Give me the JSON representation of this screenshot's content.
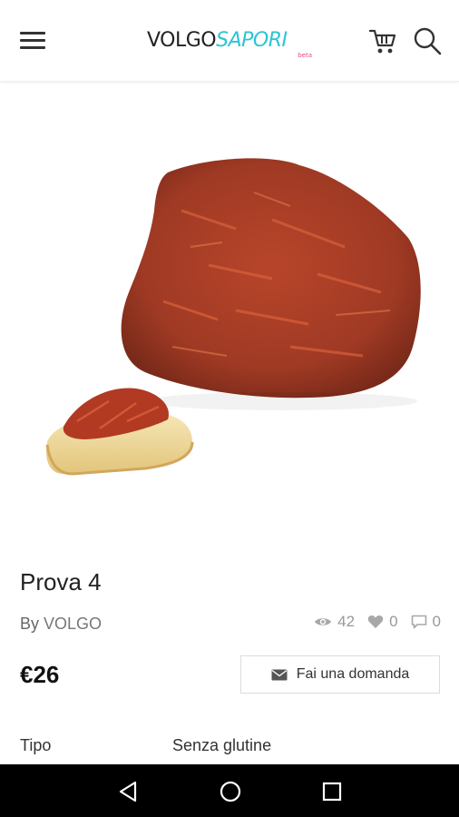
{
  "app": {
    "logo_main": "VOLGO",
    "logo_accent": "SAPORI",
    "logo_sub": "beta"
  },
  "header": {
    "menu_icon": "hamburger-menu-icon",
    "cart_icon": "shopping-cart-icon",
    "search_icon": "search-icon"
  },
  "product": {
    "title": "Prova 4",
    "by_prefix": "By",
    "vendor": "VOLGO",
    "views": "42",
    "likes": "0",
    "comments": "0",
    "price": "€26",
    "ask_label": "Fai una domanda"
  },
  "attributes": [
    {
      "label": "Tipo",
      "value": "Senza glutine"
    }
  ],
  "colors": {
    "accent": "#2ec4d6",
    "beta": "#e84a8a",
    "product_red": "#a63a22"
  },
  "system_nav": {
    "back_icon": "back-triangle-icon",
    "home_icon": "home-circle-icon",
    "recents_icon": "recents-square-icon"
  }
}
